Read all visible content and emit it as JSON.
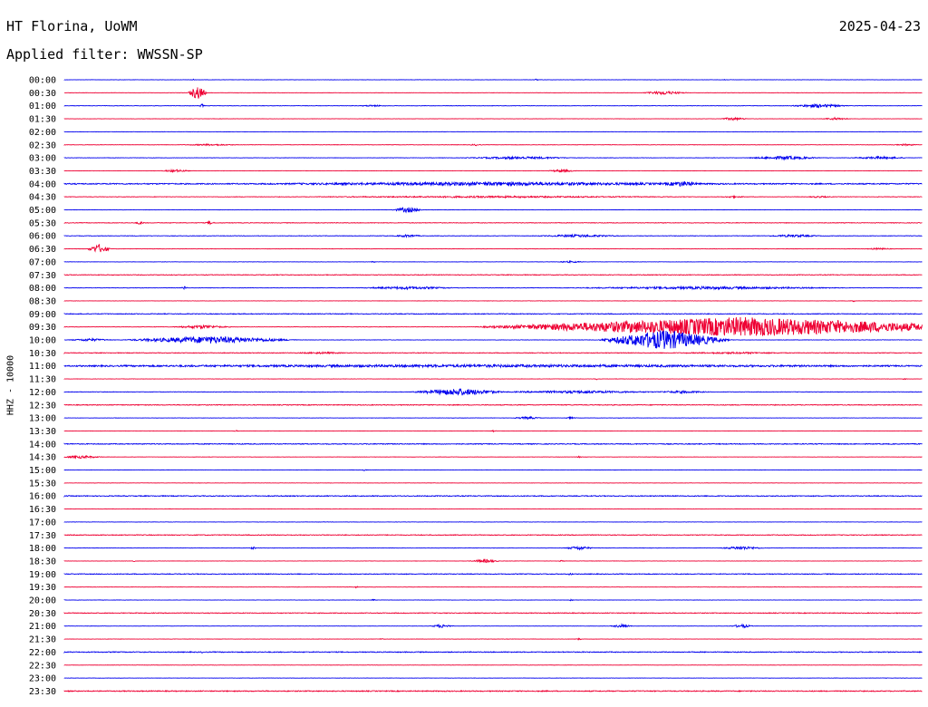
{
  "header": {
    "station": "HT Florina, UoWM",
    "date": "2025-04-23",
    "filter": "Applied filter: WWSSN-SP"
  },
  "channel_label": "HHZ - 10000",
  "colors": {
    "blue": "#0000ee",
    "red": "#ee0033"
  },
  "rows": [
    {
      "time": "00:00",
      "color": "blue",
      "noise": 0.3,
      "events": [
        {
          "pos": 0.15,
          "amp": 1,
          "dur": 0.003
        },
        {
          "pos": 0.55,
          "amp": 1,
          "dur": 0.003
        },
        {
          "pos": 0.77,
          "amp": 1,
          "dur": 0.003
        }
      ]
    },
    {
      "time": "00:30",
      "color": "red",
      "noise": 0.3,
      "events": [
        {
          "pos": 0.155,
          "amp": 8,
          "dur": 0.012
        },
        {
          "pos": 0.7,
          "amp": 2,
          "dur": 0.03
        }
      ]
    },
    {
      "time": "01:00",
      "color": "blue",
      "noise": 0.4,
      "events": [
        {
          "pos": 0.16,
          "amp": 2,
          "dur": 0.004
        },
        {
          "pos": 0.36,
          "amp": 1,
          "dur": 0.02
        },
        {
          "pos": 0.88,
          "amp": 2,
          "dur": 0.04
        }
      ]
    },
    {
      "time": "01:30",
      "color": "red",
      "noise": 0.3,
      "events": [
        {
          "pos": 0.78,
          "amp": 1.5,
          "dur": 0.02
        },
        {
          "pos": 0.9,
          "amp": 1.5,
          "dur": 0.02
        }
      ]
    },
    {
      "time": "02:00",
      "color": "blue",
      "noise": 0.3,
      "events": []
    },
    {
      "time": "02:30",
      "color": "red",
      "noise": 0.4,
      "events": [
        {
          "pos": 0.17,
          "amp": 1,
          "dur": 0.04
        },
        {
          "pos": 0.48,
          "amp": 1,
          "dur": 0.01
        },
        {
          "pos": 0.98,
          "amp": 1,
          "dur": 0.02
        }
      ]
    },
    {
      "time": "03:00",
      "color": "blue",
      "noise": 0.4,
      "events": [
        {
          "pos": 0.53,
          "amp": 1.5,
          "dur": 0.08
        },
        {
          "pos": 0.84,
          "amp": 2,
          "dur": 0.05
        },
        {
          "pos": 0.95,
          "amp": 1.5,
          "dur": 0.04
        }
      ]
    },
    {
      "time": "03:30",
      "color": "red",
      "noise": 0.3,
      "events": [
        {
          "pos": 0.13,
          "amp": 1.5,
          "dur": 0.02
        },
        {
          "pos": 0.58,
          "amp": 1.5,
          "dur": 0.02
        }
      ]
    },
    {
      "time": "04:00",
      "color": "blue",
      "noise": 1.2,
      "events": [
        {
          "pos": 0.5,
          "amp": 2,
          "dur": 0.4
        },
        {
          "pos": 0.72,
          "amp": 3,
          "dur": 0.03
        }
      ]
    },
    {
      "time": "04:30",
      "color": "red",
      "noise": 0.5,
      "events": [
        {
          "pos": 0.5,
          "amp": 1,
          "dur": 0.3
        },
        {
          "pos": 0.78,
          "amp": 1,
          "dur": 0.02
        },
        {
          "pos": 0.88,
          "amp": 1,
          "dur": 0.02
        }
      ]
    },
    {
      "time": "05:00",
      "color": "blue",
      "noise": 0.3,
      "events": [
        {
          "pos": 0.4,
          "amp": 3,
          "dur": 0.02
        }
      ]
    },
    {
      "time": "05:30",
      "color": "red",
      "noise": 0.6,
      "events": [
        {
          "pos": 0.088,
          "amp": 2,
          "dur": 0.006
        },
        {
          "pos": 0.17,
          "amp": 2,
          "dur": 0.006
        }
      ]
    },
    {
      "time": "06:00",
      "color": "blue",
      "noise": 0.5,
      "events": [
        {
          "pos": 0.4,
          "amp": 1.5,
          "dur": 0.02
        },
        {
          "pos": 0.6,
          "amp": 1.5,
          "dur": 0.06
        },
        {
          "pos": 0.85,
          "amp": 1.5,
          "dur": 0.04
        }
      ]
    },
    {
      "time": "06:30",
      "color": "red",
      "noise": 0.4,
      "events": [
        {
          "pos": 0.04,
          "amp": 5,
          "dur": 0.015
        },
        {
          "pos": 0.95,
          "amp": 1,
          "dur": 0.02
        }
      ]
    },
    {
      "time": "07:00",
      "color": "blue",
      "noise": 0.3,
      "events": [
        {
          "pos": 0.36,
          "amp": 1,
          "dur": 0.004
        },
        {
          "pos": 0.59,
          "amp": 1,
          "dur": 0.02
        }
      ]
    },
    {
      "time": "07:30",
      "color": "red",
      "noise": 0.7,
      "events": []
    },
    {
      "time": "08:00",
      "color": "blue",
      "noise": 0.4,
      "events": [
        {
          "pos": 0.14,
          "amp": 2,
          "dur": 0.004
        },
        {
          "pos": 0.4,
          "amp": 1.5,
          "dur": 0.07
        },
        {
          "pos": 0.75,
          "amp": 1.5,
          "dur": 0.2
        }
      ]
    },
    {
      "time": "08:30",
      "color": "red",
      "noise": 0.3,
      "events": [
        {
          "pos": 0.92,
          "amp": 1,
          "dur": 0.004
        }
      ]
    },
    {
      "time": "09:00",
      "color": "blue",
      "noise": 0.8,
      "events": []
    },
    {
      "time": "09:30",
      "color": "red",
      "noise": 0.4,
      "events": [
        {
          "pos": 0.16,
          "amp": 2,
          "dur": 0.04
        },
        {
          "pos": 0.79,
          "amp": 11,
          "dur": 0.32
        }
      ]
    },
    {
      "time": "10:00",
      "color": "blue",
      "noise": 0.4,
      "events": [
        {
          "pos": 0.03,
          "amp": 1.5,
          "dur": 0.03
        },
        {
          "pos": 0.17,
          "amp": 4,
          "dur": 0.11
        },
        {
          "pos": 0.7,
          "amp": 11,
          "dur": 0.08
        }
      ]
    },
    {
      "time": "10:30",
      "color": "red",
      "noise": 0.7,
      "events": [
        {
          "pos": 0.3,
          "amp": 1,
          "dur": 0.05
        },
        {
          "pos": 0.78,
          "amp": 1,
          "dur": 0.1
        }
      ]
    },
    {
      "time": "11:00",
      "color": "blue",
      "noise": 1.0,
      "events": [
        {
          "pos": 0.5,
          "amp": 1.5,
          "dur": 0.9
        }
      ]
    },
    {
      "time": "11:30",
      "color": "red",
      "noise": 0.3,
      "events": [
        {
          "pos": 0.62,
          "amp": 1,
          "dur": 0.004
        },
        {
          "pos": 0.98,
          "amp": 1,
          "dur": 0.004
        }
      ]
    },
    {
      "time": "12:00",
      "color": "blue",
      "noise": 0.5,
      "events": [
        {
          "pos": 0.46,
          "amp": 4,
          "dur": 0.06
        },
        {
          "pos": 0.6,
          "amp": 1.5,
          "dur": 0.12
        },
        {
          "pos": 0.72,
          "amp": 1.5,
          "dur": 0.04
        }
      ]
    },
    {
      "time": "12:30",
      "color": "red",
      "noise": 0.8,
      "events": []
    },
    {
      "time": "13:00",
      "color": "blue",
      "noise": 0.3,
      "events": [
        {
          "pos": 0.54,
          "amp": 1.5,
          "dur": 0.02
        },
        {
          "pos": 0.59,
          "amp": 1,
          "dur": 0.01
        }
      ]
    },
    {
      "time": "13:30",
      "color": "red",
      "noise": 0.3,
      "events": [
        {
          "pos": 0.2,
          "amp": 1,
          "dur": 0.004
        },
        {
          "pos": 0.5,
          "amp": 1,
          "dur": 0.004
        }
      ]
    },
    {
      "time": "14:00",
      "color": "blue",
      "noise": 0.9,
      "events": []
    },
    {
      "time": "14:30",
      "color": "red",
      "noise": 0.3,
      "events": [
        {
          "pos": 0.02,
          "amp": 1.5,
          "dur": 0.03
        },
        {
          "pos": 0.6,
          "amp": 1,
          "dur": 0.004
        }
      ]
    },
    {
      "time": "15:00",
      "color": "blue",
      "noise": 0.3,
      "events": [
        {
          "pos": 0.35,
          "amp": 1,
          "dur": 0.004
        }
      ]
    },
    {
      "time": "15:30",
      "color": "red",
      "noise": 0.3,
      "events": []
    },
    {
      "time": "16:00",
      "color": "blue",
      "noise": 0.9,
      "events": []
    },
    {
      "time": "16:30",
      "color": "red",
      "noise": 0.3,
      "events": []
    },
    {
      "time": "17:00",
      "color": "blue",
      "noise": 0.3,
      "events": []
    },
    {
      "time": "17:30",
      "color": "red",
      "noise": 0.8,
      "events": []
    },
    {
      "time": "18:00",
      "color": "blue",
      "noise": 0.3,
      "events": [
        {
          "pos": 0.22,
          "amp": 1.5,
          "dur": 0.004
        },
        {
          "pos": 0.6,
          "amp": 2,
          "dur": 0.02
        },
        {
          "pos": 0.79,
          "amp": 2,
          "dur": 0.03
        }
      ]
    },
    {
      "time": "18:30",
      "color": "red",
      "noise": 0.3,
      "events": [
        {
          "pos": 0.08,
          "amp": 1,
          "dur": 0.004
        },
        {
          "pos": 0.49,
          "amp": 2,
          "dur": 0.02
        },
        {
          "pos": 0.58,
          "amp": 1,
          "dur": 0.004
        }
      ]
    },
    {
      "time": "19:00",
      "color": "blue",
      "noise": 0.8,
      "events": [
        {
          "pos": 0.59,
          "amp": 1.5,
          "dur": 0.004
        }
      ]
    },
    {
      "time": "19:30",
      "color": "red",
      "noise": 0.3,
      "events": [
        {
          "pos": 0.34,
          "amp": 1,
          "dur": 0.004
        }
      ]
    },
    {
      "time": "20:00",
      "color": "blue",
      "noise": 0.3,
      "events": [
        {
          "pos": 0.36,
          "amp": 1,
          "dur": 0.004
        },
        {
          "pos": 0.59,
          "amp": 1,
          "dur": 0.004
        }
      ]
    },
    {
      "time": "20:30",
      "color": "red",
      "noise": 0.8,
      "events": []
    },
    {
      "time": "21:00",
      "color": "blue",
      "noise": 0.3,
      "events": [
        {
          "pos": 0.44,
          "amp": 2,
          "dur": 0.015
        },
        {
          "pos": 0.65,
          "amp": 2,
          "dur": 0.015
        },
        {
          "pos": 0.79,
          "amp": 2,
          "dur": 0.015
        }
      ]
    },
    {
      "time": "21:30",
      "color": "red",
      "noise": 0.3,
      "events": [
        {
          "pos": 0.37,
          "amp": 1,
          "dur": 0.004
        },
        {
          "pos": 0.6,
          "amp": 1,
          "dur": 0.004
        }
      ]
    },
    {
      "time": "22:00",
      "color": "blue",
      "noise": 0.9,
      "events": [
        {
          "pos": 0.16,
          "amp": 1,
          "dur": 0.004
        }
      ]
    },
    {
      "time": "22:30",
      "color": "red",
      "noise": 0.3,
      "events": []
    },
    {
      "time": "23:00",
      "color": "blue",
      "noise": 0.3,
      "events": []
    },
    {
      "time": "23:30",
      "color": "red",
      "noise": 1.0,
      "events": []
    }
  ]
}
